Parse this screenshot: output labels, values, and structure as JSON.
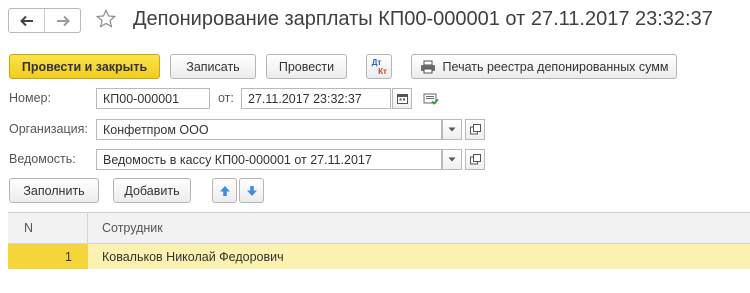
{
  "header": {
    "title": "Депонирование зарплаты КП00-000001 от 27.11.2017 23:32:37",
    "back_icon": "arrow-left-icon",
    "forward_icon": "arrow-right-icon",
    "favorite_icon": "star-icon"
  },
  "toolbar": {
    "post_and_close": "Провести и закрыть",
    "save": "Записать",
    "post": "Провести",
    "dt_kt_top": "Дт",
    "dt_kt_bottom": "Кт",
    "print": "Печать реестра депонированных сумм"
  },
  "form": {
    "number_label": "Номер:",
    "number_value": "КП00-000001",
    "date_label": "от:",
    "date_value": "27.11.2017 23:32:37",
    "org_label": "Организация:",
    "org_value": "Конфетпром ООО",
    "statement_label": "Ведомость:",
    "statement_value": "Ведомость в кассу КП00-000001 от 27.11.2017"
  },
  "table_toolbar": {
    "fill": "Заполнить",
    "add": "Добавить"
  },
  "table": {
    "columns": [
      "N",
      "Сотрудник"
    ],
    "rows": [
      {
        "n": "1",
        "employee": "Ковальков Николай Федорович"
      }
    ]
  },
  "colors": {
    "accent": "#f4d63a",
    "selected_row": "#fbf1b0",
    "arrow_blue": "#3f8de0"
  }
}
